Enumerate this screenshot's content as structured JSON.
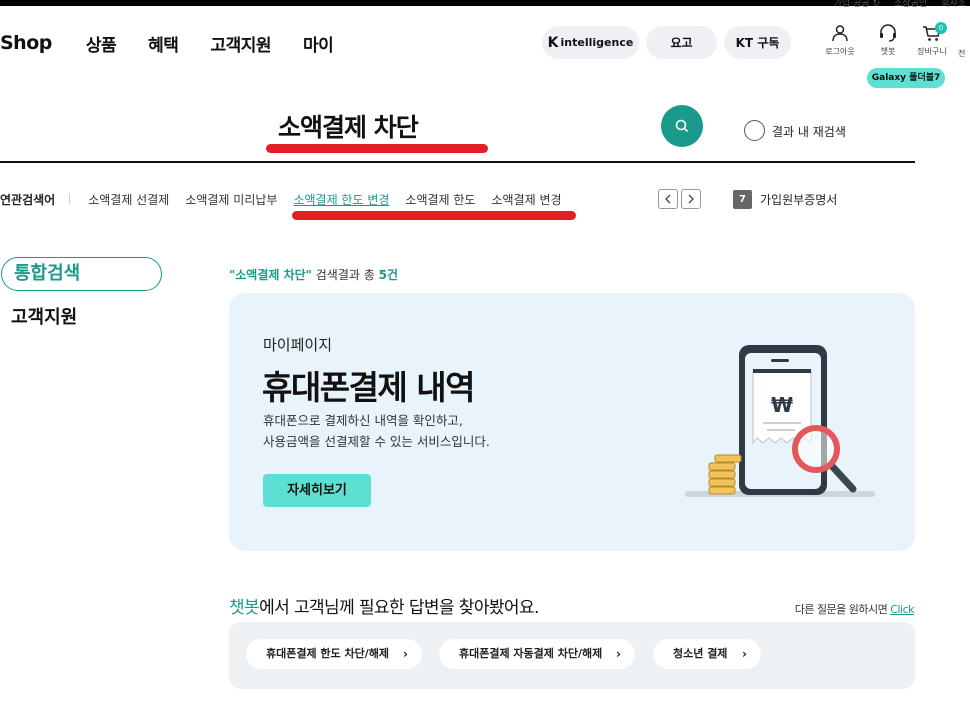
{
  "utility_links": [
    "가입·공공 ↻",
    "소상공인",
    "회사소"
  ],
  "gnb": {
    "brand": "Shop",
    "menus": [
      "상품",
      "혜택",
      "고객지원",
      "마이"
    ]
  },
  "header_pills": {
    "intelligence_k": "K",
    "intelligence": "intelligence",
    "yogo": "요고",
    "kt_subscribe": "KT 구독"
  },
  "header_icons": {
    "logout": "로그아웃",
    "chatbot": "챗봇",
    "cart": "장바구니",
    "cart_count": "0",
    "more": "전"
  },
  "galaxy_tooltip": "Galaxy 폴더블7",
  "search": {
    "query": "소액결제 차단",
    "in_result_label": "결과 내 재검색"
  },
  "related": {
    "title": "연관검색어",
    "keywords": [
      "소액결제 선결제",
      "소액결제 미리납부",
      "소액결제 한도 변경",
      "소액결제 한도",
      "소액결제 변경"
    ],
    "active_index": 2
  },
  "doc_badge": {
    "icon": "7",
    "label": "가입원부증명서"
  },
  "sidebar": {
    "items": [
      "통합검색",
      "고객지원"
    ]
  },
  "result_summary": {
    "query": "\"소액결제 차단\"",
    "text": " 검색결과 총 ",
    "count": "5건"
  },
  "card": {
    "category": "마이페이지",
    "title": "휴대폰결제 내역",
    "desc_line1": "휴대폰으로 결제하신 내역을 확인하고,",
    "desc_line2": "사용금액을 선결제할 수 있는 서비스입니다.",
    "button": "자세히보기",
    "illustration_icon": "receipt-magnifier-icon",
    "won_symbol": "₩"
  },
  "chatbot": {
    "heading_bot": "챗봇",
    "heading_rest": "에서 고객님께 필요한 답변을 찾아봤어요.",
    "more_text": "다른 질문을 원하시면 ",
    "more_link": "Click",
    "chips": [
      "휴대폰결제 한도 차단/해제",
      "휴대폰결제 자동결제 차단/해제",
      "청소년 결제"
    ],
    "chip_arrow": "›"
  },
  "colors": {
    "teal": "#1a9a8c",
    "mint": "#5de0d3",
    "red_annotation": "#e21f26",
    "card_bg": "#e9f3fb"
  }
}
